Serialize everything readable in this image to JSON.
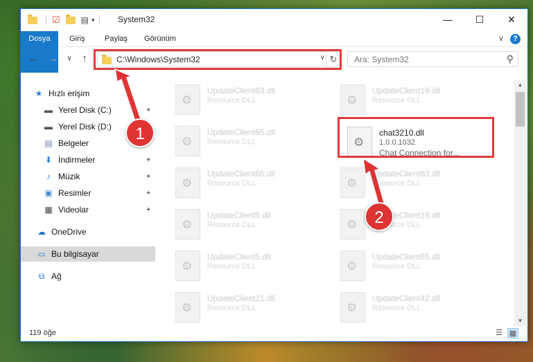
{
  "window": {
    "title": "System32",
    "minimize_glyph": "—",
    "maximize_glyph": "☐",
    "close_glyph": "✕"
  },
  "ribbon": {
    "tabs": [
      "Dosya",
      "Giriş",
      "Paylaş",
      "Görünüm"
    ],
    "help_glyph": "?",
    "collapse_glyph": "∨"
  },
  "navigation": {
    "back_glyph": "←",
    "forward_glyph": "→",
    "recent_glyph": "∨",
    "up_glyph": "↑",
    "address": "C:\\Windows\\System32",
    "address_dropdown_glyph": "∨",
    "refresh_glyph": "↻",
    "search_placeholder": "Ara: System32",
    "search_glyph": "⚲"
  },
  "sidebar": {
    "items": [
      {
        "label": "Hızlı erişim",
        "icon": "star-icon",
        "glyph": "★",
        "color": "#2a7fd4",
        "pinned": false
      },
      {
        "label": "Yerel Disk (C:)",
        "icon": "drive-icon",
        "glyph": "▬",
        "color": "#555555",
        "pinned": true
      },
      {
        "label": "Yerel Disk (D:)",
        "icon": "drive-icon",
        "glyph": "▬",
        "color": "#555555",
        "pinned": true
      },
      {
        "label": "Belgeler",
        "icon": "documents-icon",
        "glyph": "▤",
        "color": "#6a7fa0",
        "pinned": true
      },
      {
        "label": "İndirmeler",
        "icon": "download-icon",
        "glyph": "⬇",
        "color": "#2a7fd4",
        "pinned": true
      },
      {
        "label": "Müzik",
        "icon": "music-icon",
        "glyph": "♪",
        "color": "#2a7fd4",
        "pinned": true
      },
      {
        "label": "Resimler",
        "icon": "pictures-icon",
        "glyph": "▣",
        "color": "#4a8ac8",
        "pinned": true
      },
      {
        "label": "Videolar",
        "icon": "videos-icon",
        "glyph": "▦",
        "color": "#444444",
        "pinned": true
      },
      {
        "label": "OneDrive",
        "icon": "cloud-icon",
        "glyph": "☁",
        "color": "#1f6fc5",
        "pinned": false
      },
      {
        "label": "Bu bilgisayar",
        "icon": "computer-icon",
        "glyph": "▭",
        "color": "#2a7fd4",
        "pinned": false
      },
      {
        "label": "Ağ",
        "icon": "network-icon",
        "glyph": "⧉",
        "color": "#2a7fd4",
        "pinned": false
      }
    ],
    "pin_glyph": "📌"
  },
  "files": {
    "left_column": [
      {
        "name": "UpdateClient63.dll",
        "type": "Resource DLL"
      },
      {
        "name": "UpdateClient65.dll",
        "type": "Resource DLL"
      },
      {
        "name": "UpdateClient65.dll",
        "type": "Resource DLL"
      },
      {
        "name": "UpdateClient5.dll",
        "type": "Resource DLL"
      },
      {
        "name": "UpdateClient5.dll",
        "type": "Resource DLL"
      },
      {
        "name": "UpdateClient21.dll",
        "type": "Resource DLL"
      }
    ],
    "right_column": [
      {
        "name": "UpdateClient19.dll",
        "type": "Resource DLL"
      },
      {
        "name": "UpdateClient63.dll",
        "type": "Resource DLL"
      },
      {
        "name": "UpdateClient19.dll",
        "type": "Resource DLL"
      },
      {
        "name": "UpdateClient65.dll",
        "type": "Resource DLL"
      },
      {
        "name": "UpdateClient42.dll",
        "type": "Resource DLL"
      }
    ],
    "featured": {
      "name": "chat3210.dll",
      "version": "1.0.0.1032",
      "description": "Chat Connection for..."
    }
  },
  "status": {
    "item_count": "119 öğe"
  },
  "annotations": {
    "badge_1": "1",
    "badge_2": "2",
    "highlight_color": "#e03a3a"
  }
}
